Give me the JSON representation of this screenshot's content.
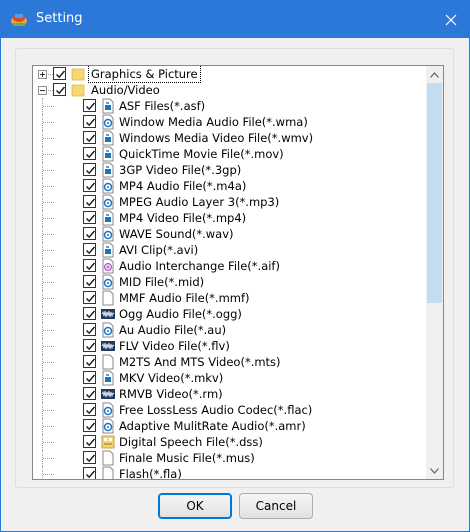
{
  "window": {
    "title": "Setting",
    "close_icon": "close-icon",
    "app_icon": "app-logo-icon"
  },
  "tree": {
    "nodes": [
      {
        "label": "Graphics & Picture",
        "level": 0,
        "expander": "plus",
        "checked": true,
        "icon": "folder-icon",
        "selected": true
      },
      {
        "label": "Audio/Video",
        "level": 0,
        "expander": "minus",
        "checked": true,
        "icon": "folder-icon"
      },
      {
        "label": "ASF Files(*.asf)",
        "level": 1,
        "checked": true,
        "icon": "media-file-icon"
      },
      {
        "label": "Window Media Audio File(*.wma)",
        "level": 1,
        "checked": true,
        "icon": "audio-file-icon"
      },
      {
        "label": "Windows Media Video File(*.wmv)",
        "level": 1,
        "checked": true,
        "icon": "media-file-icon"
      },
      {
        "label": "QuickTime Movie File(*.mov)",
        "level": 1,
        "checked": true,
        "icon": "media-file-icon"
      },
      {
        "label": "3GP Video File(*.3gp)",
        "level": 1,
        "checked": true,
        "icon": "media-file-icon"
      },
      {
        "label": "MP4 Audio File(*.m4a)",
        "level": 1,
        "checked": true,
        "icon": "audio-file-icon"
      },
      {
        "label": "MPEG Audio Layer 3(*.mp3)",
        "level": 1,
        "checked": true,
        "icon": "audio-file-icon"
      },
      {
        "label": "MP4 Video File(*.mp4)",
        "level": 1,
        "checked": true,
        "icon": "media-file-icon"
      },
      {
        "label": "WAVE Sound(*.wav)",
        "level": 1,
        "checked": true,
        "icon": "audio-file-icon"
      },
      {
        "label": "AVI Clip(*.avi)",
        "level": 1,
        "checked": true,
        "icon": "media-file-icon"
      },
      {
        "label": "Audio Interchange File(*.aif)",
        "level": 1,
        "checked": true,
        "icon": "aif-file-icon"
      },
      {
        "label": "MID File(*.mid)",
        "level": 1,
        "checked": true,
        "icon": "audio-file-icon"
      },
      {
        "label": "MMF Audio File(*.mmf)",
        "level": 1,
        "checked": true,
        "icon": "blank-file-icon"
      },
      {
        "label": "Ogg Audio File(*.ogg)",
        "level": 1,
        "checked": true,
        "icon": "waveform-icon"
      },
      {
        "label": "Au Audio File(*.au)",
        "level": 1,
        "checked": true,
        "icon": "audio-file-icon"
      },
      {
        "label": "FLV Video File(*.flv)",
        "level": 1,
        "checked": true,
        "icon": "waveform-icon"
      },
      {
        "label": "M2TS And MTS Video(*.mts)",
        "level": 1,
        "checked": true,
        "icon": "blank-file-icon"
      },
      {
        "label": "MKV Video(*.mkv)",
        "level": 1,
        "checked": true,
        "icon": "media-file-icon"
      },
      {
        "label": "RMVB Video(*.rm)",
        "level": 1,
        "checked": true,
        "icon": "waveform-icon"
      },
      {
        "label": "Free LossLess Audio Codec(*.flac)",
        "level": 1,
        "checked": true,
        "icon": "audio-file-icon"
      },
      {
        "label": "Adaptive MulitRate Audio(*.amr)",
        "level": 1,
        "checked": true,
        "icon": "audio-file-icon"
      },
      {
        "label": "Digital Speech File(*.dss)",
        "level": 1,
        "checked": true,
        "icon": "speech-file-icon"
      },
      {
        "label": "Finale Music File(*.mus)",
        "level": 1,
        "checked": true,
        "icon": "blank-file-icon"
      },
      {
        "label": "Flash(*.fla)",
        "level": 1,
        "checked": true,
        "icon": "blank-file-icon"
      }
    ]
  },
  "scrollbar": {
    "up_icon": "scroll-up-arrow-icon",
    "down_icon": "scroll-down-arrow-icon",
    "position_fraction": 0.0,
    "visible_fraction": 0.58
  },
  "buttons": {
    "ok_label": "OK",
    "cancel_label": "Cancel"
  },
  "colors": {
    "title_bar": "#2b78d8",
    "accent_blue": "#0078d7",
    "folder": "#f8d775",
    "scroll_thumb": "#c2dcf0"
  }
}
